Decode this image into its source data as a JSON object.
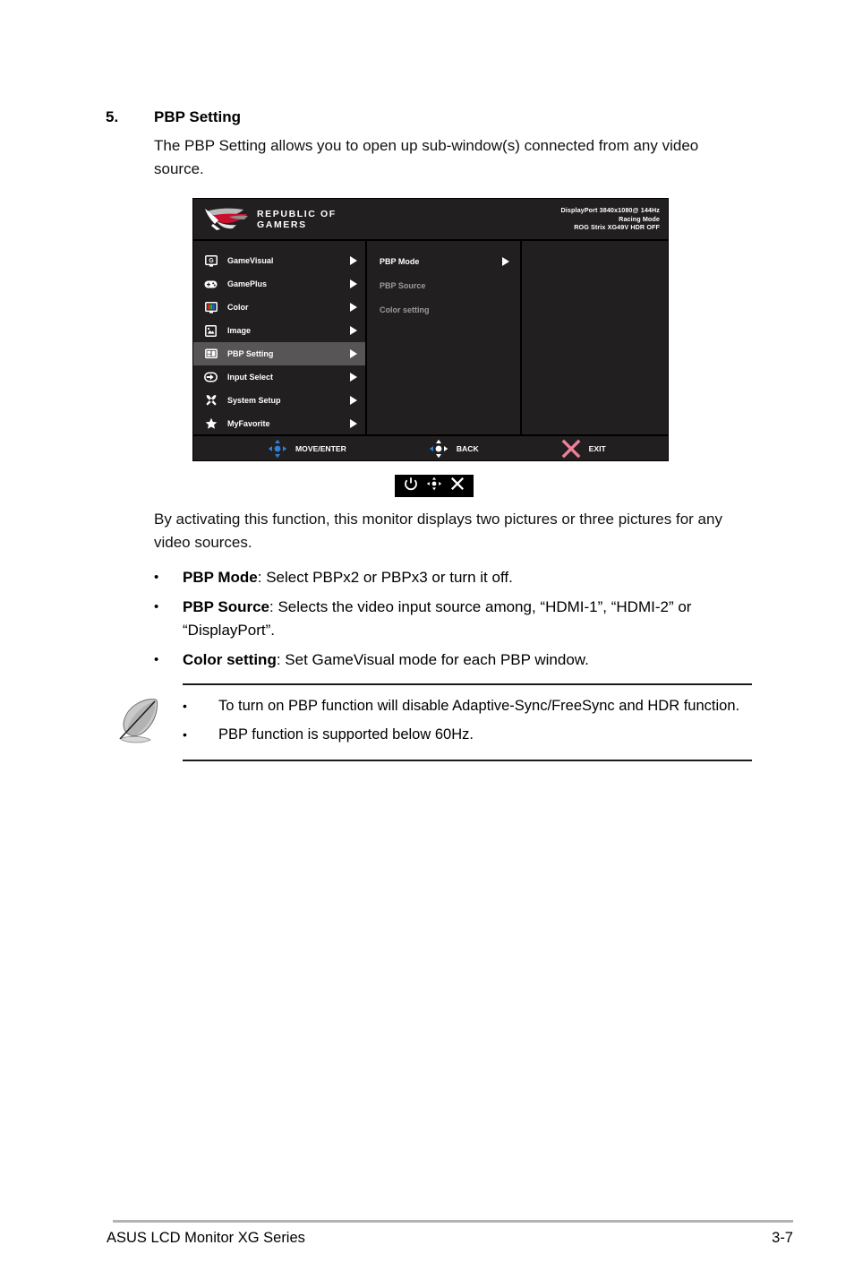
{
  "section": {
    "number": "5.",
    "title": "PBP Setting",
    "intro": "The PBP Setting allows you to open up sub-window(s) connected from any video source."
  },
  "osd": {
    "logo_text_line1": "Republic of",
    "logo_text_line2": "Gamers",
    "status": {
      "line1": "DisplayPort 3840x1080@ 144Hz",
      "line2": "Racing Mode",
      "line3": "ROG Strix XG49V HDR OFF"
    },
    "menu_items": [
      {
        "label": "GameVisual",
        "icon": "gamevisual-icon",
        "selected": false
      },
      {
        "label": "GamePlus",
        "icon": "gameplus-icon",
        "selected": false
      },
      {
        "label": "Color",
        "icon": "color-icon",
        "selected": false
      },
      {
        "label": "Image",
        "icon": "image-icon",
        "selected": false
      },
      {
        "label": "PBP Setting",
        "icon": "pbp-setting-icon",
        "selected": true
      },
      {
        "label": "Input Select",
        "icon": "input-select-icon",
        "selected": false
      },
      {
        "label": "System Setup",
        "icon": "system-setup-icon",
        "selected": false
      },
      {
        "label": "MyFavorite",
        "icon": "myfavorite-icon",
        "selected": false
      }
    ],
    "submenu_items": [
      {
        "label": "PBP Mode",
        "active": true,
        "has_arrow": true
      },
      {
        "label": "PBP Source",
        "active": false,
        "has_arrow": false
      },
      {
        "label": "Color setting",
        "active": false,
        "has_arrow": false
      }
    ],
    "footer": {
      "move": "MOVE/ENTER",
      "back": "BACK",
      "exit": "EXIT"
    },
    "colors": {
      "panel_bg": "#221f20",
      "selected_row": "#585557",
      "dim_text": "#9b9b9b",
      "dpad_blue": "#2f7fd4",
      "exit_pink": "#f08098",
      "logo_red": "#c8102e"
    }
  },
  "keystrip": {
    "power_icon": "power-icon",
    "joystick_icon": "joystick-dpad-icon",
    "close_icon": "close-x-icon"
  },
  "body": {
    "activate_para": "By activating this function, this monitor displays two pictures or three pictures for any video sources.",
    "bullets": [
      {
        "bullet": "•",
        "term": "PBP Mode",
        "rest": ": Select PBPx2 or PBPx3 or turn it off."
      },
      {
        "bullet": "•",
        "term": "PBP Source",
        "rest": ": Selects the video input source among, “HDMI-1”, “HDMI-2” or “DisplayPort”."
      },
      {
        "bullet": "•",
        "term": "Color setting",
        "rest": ":  Set GameVisual mode for each PBP window."
      }
    ]
  },
  "note": {
    "icon": "quill-pen-icon",
    "items": [
      {
        "bullet": "•",
        "text": "To turn on PBP function will disable Adaptive-Sync/FreeSync and HDR function."
      },
      {
        "bullet": "•",
        "text": "PBP function is supported below 60Hz."
      }
    ]
  },
  "page_footer": {
    "left": "ASUS LCD Monitor XG Series",
    "right": "3-7"
  }
}
